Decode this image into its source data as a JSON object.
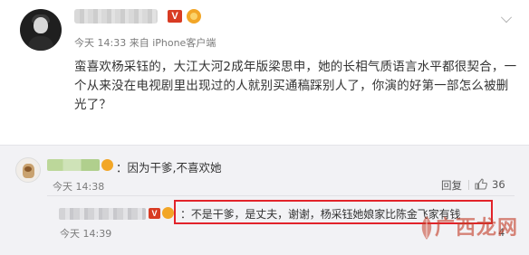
{
  "post": {
    "username": "",
    "vip_label": "V",
    "meta": "今天 14:33 来自 iPhone客户端",
    "text": "蛮喜欢杨采钰的，大江大河2成年版梁思申，她的长相气质语言水平都很契合，一个从来没在电视剧里出现过的人就别买通稿踩别人了，你演的好第一部怎么被删光了？"
  },
  "comments": [
    {
      "name": "",
      "text": "：因为干爹,不喜欢她",
      "time": "今天 14:38",
      "reply_label": "回复",
      "like_count": "36"
    }
  ],
  "reply": {
    "name": "",
    "vip_label": "V",
    "text": "：不是干爹，是丈夫，谢谢，杨采钰她娘家比陈金飞家有钱",
    "time": "今天 14:39",
    "count": "4"
  },
  "watermark": {
    "text": "广西龙网"
  },
  "colors": {
    "highlight_border": "#e2232a",
    "vip_badge": "#d83b23",
    "level_badge": "#f2a627",
    "panel_bg": "#f2f2f5"
  }
}
